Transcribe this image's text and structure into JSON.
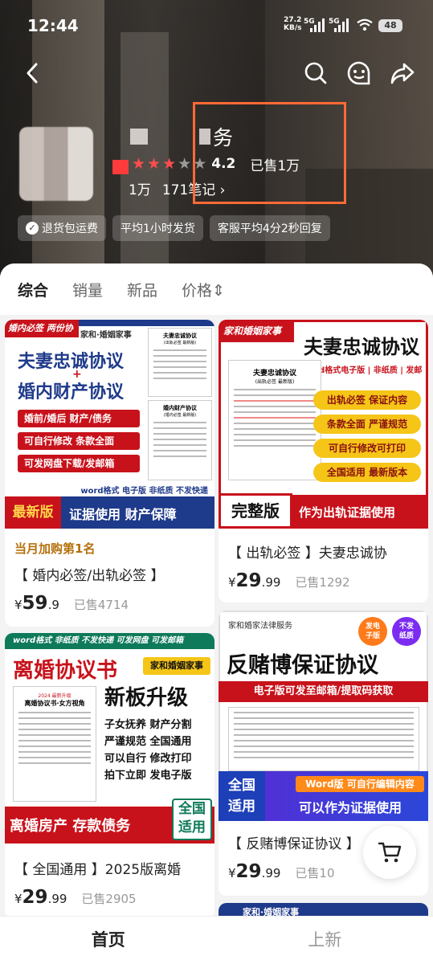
{
  "status_bar": {
    "time": "12:44",
    "net_speed": "27.2",
    "net_unit": "KB/s",
    "sim1": "5G",
    "sim2": "5G",
    "battery": "48"
  },
  "store": {
    "name_visible": "务",
    "rating": "4.2",
    "sold": "已售1万",
    "followers": "1万",
    "notes": "171",
    "notes_suffix": "笔记 ›",
    "stars_filled": 3,
    "stars_total": 5
  },
  "service_tags": [
    {
      "label": "退货包运费"
    },
    {
      "label": "平均1小时发货"
    },
    {
      "label": "客服平均4分2秒回复"
    }
  ],
  "filters": [
    "综合",
    "销量",
    "新品",
    "价格⇕"
  ],
  "products": [
    {
      "promo": "当月加购第1名",
      "caption": "【 婚内必签/出轨必签 】",
      "price_int": "59",
      "price_dec": ".9",
      "sold": "已售4714",
      "art": {
        "corner": "婚内必签  两份协议",
        "brand": "家和·婚姻家事",
        "title1": "夫妻忠诚协议",
        "plus": "+",
        "title2": "婚内财产协议",
        "chips": [
          "婚前/婚后 财产/债务",
          "可自行修改 条款全面",
          "可发网盘下载/发邮箱"
        ],
        "doc_title1": "夫妻忠诚协议",
        "doc_sub1": "(出轨必签 最新版)",
        "doc_title2": "婚内财产协议",
        "doc_sub2": "(婚内必签 最新版)",
        "strip": "word格式 电子版  非纸质  不发快递",
        "badge": "最新版",
        "bottom": "证据使用 财产保障"
      }
    },
    {
      "caption": "【 出轨必签 】夫妻忠诚协",
      "price_int": "29",
      "price_dec": ".99",
      "sold": "已售1292",
      "art": {
        "corner": "家和婚姻家事",
        "title": "夫妻忠诚协议",
        "sub": "word格式电子版 | 非纸质 | 发邮箱",
        "doc_title": "夫妻忠诚协议",
        "doc_sub": "(出轨必签 最新版)",
        "chips": [
          "出轨必签 保证内容",
          "条款全面 严谨规范",
          "可自行修改可打印",
          "全国适用 最新版本"
        ],
        "badge": "完整版",
        "bottom": "作为出轨证据使用"
      }
    },
    {
      "caption": "【 全国通用 】2025版离婚",
      "price_int": "29",
      "price_dec": ".99",
      "sold": "已售2905",
      "art": {
        "strip": "word格式  非纸质  不发快递  可发网盘  可发邮箱",
        "title": "离婚协议书",
        "brand": "家和婚姻家事",
        "headline": "新板升级",
        "doc_top": "2024 最新升级",
        "doc_title": "离婚协议书·女方视角",
        "features": [
          "子女抚养 财产分割",
          "严谨规范 全国通用",
          "可以自行 修改打印",
          "拍下立即 发电子版"
        ],
        "bottom": "离婚房产 存款债务",
        "stamp1": "全国",
        "stamp2": "适用"
      }
    },
    {
      "caption": "【 反赌博保证协议 】",
      "price_int": "29",
      "price_dec": ".99",
      "sold": "已售10",
      "art": {
        "brand": "家和婚家法律服务",
        "circle1_a": "发电",
        "circle1_b": "子版",
        "circle2_a": "不发",
        "circle2_b": "纸质",
        "title": "反赌博保证协议",
        "sub": "电子版可发至邮箱/提取码获取",
        "badge1": "全国",
        "badge2": "适用",
        "chip": "Word版  可自行编辑内容",
        "bottom": "可以作为证据使用"
      }
    },
    {
      "art": {
        "peek": "家和·婚姻家事"
      }
    }
  ],
  "tabbar": [
    {
      "label": "首页"
    },
    {
      "label": "上新"
    }
  ],
  "colors": {
    "accent_red": "#c8121b",
    "highlight_orange": "#ff6a36",
    "navy": "#1e3a8a"
  }
}
